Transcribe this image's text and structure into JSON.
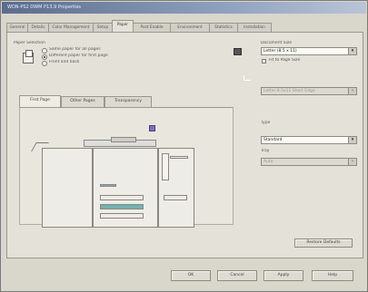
{
  "window": {
    "title": "WDN-PS2 DWM P13.9 Properties"
  },
  "tabs": [
    {
      "label": "General"
    },
    {
      "label": "Details"
    },
    {
      "label": "Color Management"
    },
    {
      "label": "Setup"
    },
    {
      "label": "Paper"
    },
    {
      "label": "Post Enable"
    },
    {
      "label": "Environment"
    },
    {
      "label": "Statistics"
    },
    {
      "label": "Installation"
    }
  ],
  "active_tab": "Paper",
  "paper_selection": {
    "group_label": "Paper Selection",
    "options": [
      {
        "label": "Same paper for all pages",
        "selected": false
      },
      {
        "label": "Different paper for first page",
        "selected": true
      },
      {
        "label": "Front and back",
        "selected": false
      }
    ]
  },
  "document_size": {
    "label": "Document Size",
    "value": "Letter (8.5 x 11)",
    "fit_checkbox_label": "Fit to Page Size",
    "output_value": "Letter 8.5x11 Short Edge"
  },
  "page_tabs": [
    {
      "label": "First Page"
    },
    {
      "label": "Other Pages"
    },
    {
      "label": "Transparency"
    }
  ],
  "active_page_tab": "First Page",
  "type": {
    "label": "Type",
    "value": "Standard"
  },
  "tray": {
    "label": "Tray",
    "value": "Auto"
  },
  "buttons": {
    "restore_defaults": "Restore Defaults",
    "ok": "OK",
    "cancel": "Cancel",
    "apply": "Apply",
    "help": "Help"
  },
  "colors": {
    "titlebar": "#5b6c8d",
    "dialog": "#d9d6cc",
    "accent_tray": "#6fb3b1"
  }
}
